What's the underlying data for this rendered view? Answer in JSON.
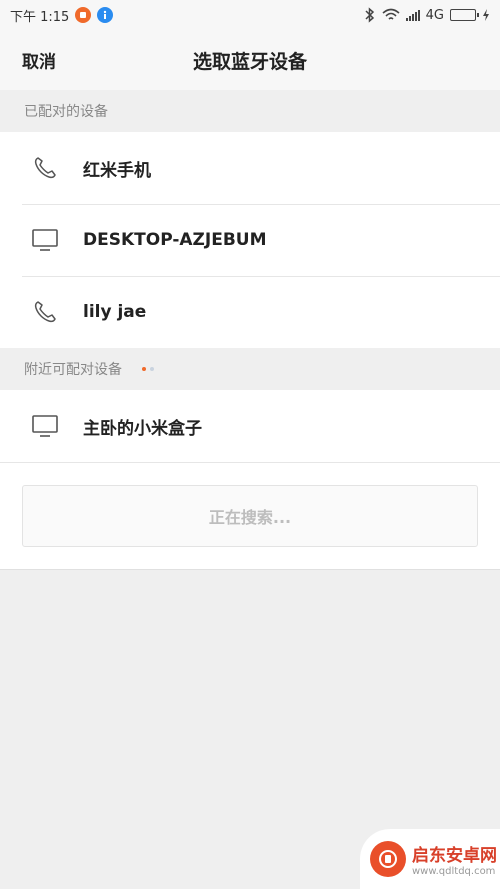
{
  "status_bar": {
    "time": "下午 1:15",
    "network": "4G",
    "battery_level": 0.7,
    "icons": [
      "bluetooth-icon",
      "wifi-icon",
      "signal-icon",
      "battery-icon",
      "charging-icon"
    ]
  },
  "header": {
    "cancel_label": "取消",
    "title": "选取蓝牙设备"
  },
  "paired": {
    "label": "已配对的设备",
    "devices": [
      {
        "name": "红米手机",
        "icon": "phone-icon"
      },
      {
        "name": "DESKTOP-AZJEBUM",
        "icon": "monitor-icon"
      },
      {
        "name": "lily jae",
        "icon": "phone-icon"
      }
    ]
  },
  "nearby": {
    "label": "附近可配对设备",
    "devices": [
      {
        "name": "主卧的小米盒子",
        "icon": "monitor-icon"
      }
    ],
    "searching_label": "正在搜索..."
  },
  "colors": {
    "accent_dot": "#f06a2b",
    "inactive_dot": "#c9d3df",
    "battery_green": "#37c14a"
  },
  "watermark": {
    "title": "启东安卓网",
    "url": "www.qdltdq.com"
  }
}
